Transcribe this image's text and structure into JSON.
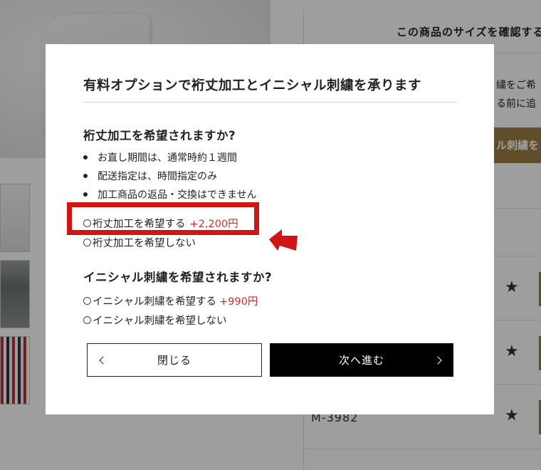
{
  "background": {
    "size_check_title": "この商品のサイズを確認する",
    "info_line1": "繍をご希",
    "info_line2": "る前に追",
    "gold_button_label": "ル刺繍を",
    "model_code": "M-3982",
    "star_glyph": "★"
  },
  "modal": {
    "title": "有料オプションで裄丈加工とイニシャル刺繍を承ります",
    "sleeve": {
      "heading": "裄丈加工を希望されますか?",
      "notes": [
        "お直し期間は、通常時約１週間",
        "配送指定は、時間指定のみ",
        "加工商品の返品・交換はできません"
      ],
      "option_yes": "裄丈加工を希望する",
      "option_yes_price": "+2,200円",
      "option_no": "裄丈加工を希望しない"
    },
    "initial": {
      "heading": "イニシャル刺繍を希望されますか?",
      "option_yes": "イニシャル刺繍を希望する",
      "option_yes_price": "+990円",
      "option_no": "イニシャル刺繍を希望しない"
    },
    "close_button": "閉じる",
    "next_button": "次へ進む"
  },
  "colors": {
    "price": "#d22d2d",
    "highlight": "#d01515",
    "accent_gold": "#9c7c45"
  }
}
